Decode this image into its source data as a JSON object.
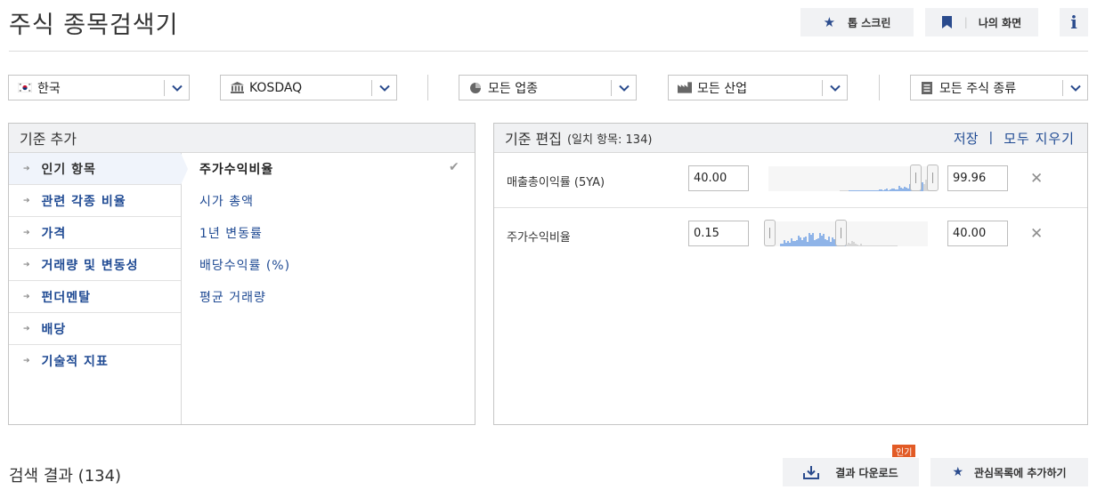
{
  "header": {
    "title": "주식 종목검색기",
    "top_screens_label": "톱 스크린",
    "my_screens_label": "나의 화면",
    "info_label": "i"
  },
  "filters": [
    {
      "label": "한국",
      "icon": "korea-flag-icon"
    },
    {
      "label": "KOSDAQ",
      "icon": "exchange-building-icon"
    },
    {
      "label": "모든 업종",
      "icon": "pie-chart-icon"
    },
    {
      "label": "모든 산업",
      "icon": "factory-icon"
    },
    {
      "label": "모든 주식 종류",
      "icon": "document-icon"
    }
  ],
  "add_criteria": {
    "title": "기준 추가",
    "categories": [
      "인기 항목",
      "관련 각종 비율",
      "가격",
      "거래량 및 변동성",
      "펀더멘탈",
      "배당",
      "기술적 지표"
    ],
    "active_category": "인기 항목",
    "items": [
      "주가수익비율",
      "시가 총액",
      "1년 변동률",
      "배당수익률 (%)",
      "평균 거래량"
    ],
    "selected_item": "주가수익비율"
  },
  "edit_criteria": {
    "title": "기준 편집",
    "match_text": "(일치 항목: 134)",
    "save_label": "저장",
    "separator": "|",
    "clear_all_label": "모두 지우기",
    "rows": [
      {
        "name": "매출총이익률 (5YA)",
        "min": "40.00",
        "max": "99.96"
      },
      {
        "name": "주가수익비율",
        "min": "0.15",
        "max": "40.00"
      }
    ]
  },
  "results": {
    "title": "검색 결과 (134)",
    "download_label": "결과 다운로드",
    "popular_badge": "인기",
    "watchlist_label": "관심목록에 추가하기"
  },
  "colors": {
    "link_blue": "#1f4a93",
    "bar_blue": "#8fb4e8",
    "bar_gray": "#d6d6d6",
    "badge_orange": "#e25b26"
  }
}
